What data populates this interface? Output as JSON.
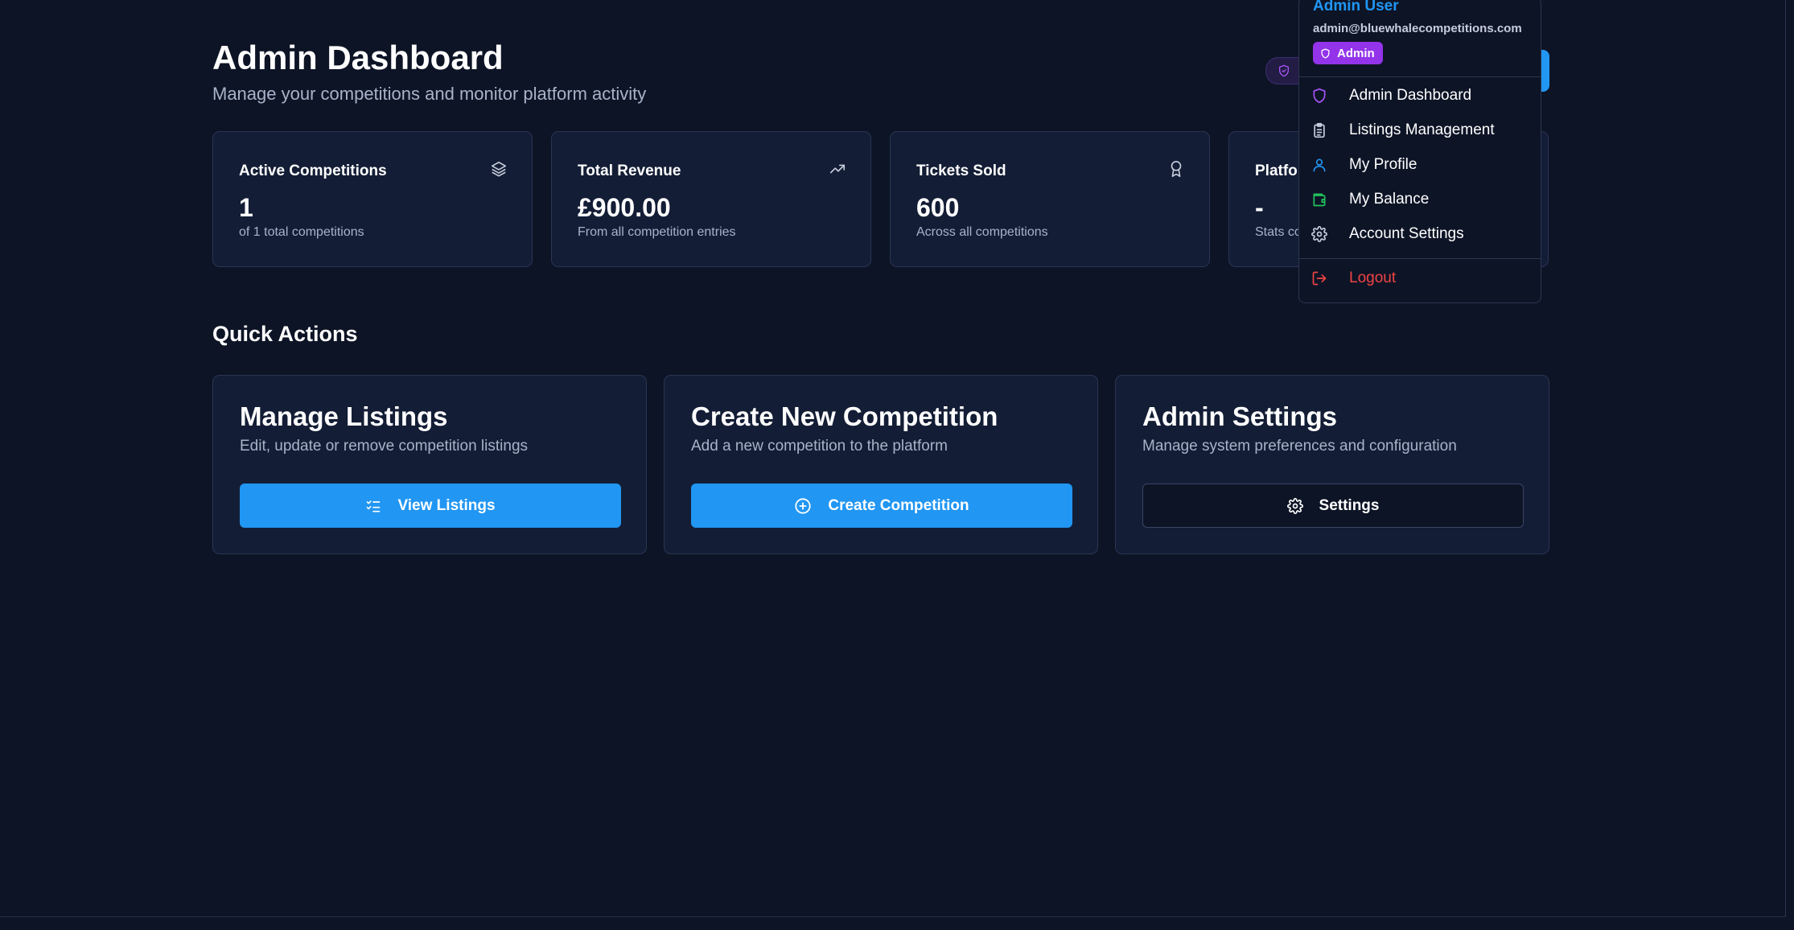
{
  "header": {
    "title": "Admin Dashboard",
    "subtitle": "Manage your competitions and monitor platform activity"
  },
  "stats": [
    {
      "label": "Active Competitions",
      "value": "1",
      "sub": "of 1 total competitions",
      "icon": "layers-icon"
    },
    {
      "label": "Total Revenue",
      "value": "£900.00",
      "sub": "From all competition entries",
      "icon": "trending-up-icon"
    },
    {
      "label": "Tickets Sold",
      "value": "600",
      "sub": "Across all competitions",
      "icon": "award-icon"
    },
    {
      "label": "Platfor",
      "value": "-",
      "sub": "Stats co",
      "icon": ""
    }
  ],
  "quick_actions": {
    "title": "Quick Actions",
    "cards": [
      {
        "title": "Manage Listings",
        "desc": "Edit, update or remove competition listings",
        "button": "View Listings",
        "icon": "list-checks-icon"
      },
      {
        "title": "Create New Competition",
        "desc": "Add a new competition to the platform",
        "button": "Create Competition",
        "icon": "plus-circle-icon"
      },
      {
        "title": "Admin Settings",
        "desc": "Manage system preferences and configuration",
        "button": "Settings",
        "icon": "gear-icon"
      }
    ]
  },
  "user_menu": {
    "name": "Admin User",
    "email": "admin@bluewhalecompetitions.com",
    "badge": "Admin",
    "items": [
      {
        "label": "Admin Dashboard",
        "icon": "shield-icon"
      },
      {
        "label": "Listings Management",
        "icon": "clipboard-icon"
      },
      {
        "label": "My Profile",
        "icon": "user-icon"
      },
      {
        "label": "My Balance",
        "icon": "wallet-icon"
      },
      {
        "label": "Account Settings",
        "icon": "gear-icon"
      }
    ],
    "logout": {
      "label": "Logout",
      "icon": "logout-icon"
    }
  },
  "colors": {
    "background": "#0d1426",
    "card": "#131d35",
    "accent_blue": "#2196f3",
    "admin_purple": "#9333ea",
    "logout_red": "#ef4444",
    "wallet_green": "#22c55e"
  }
}
